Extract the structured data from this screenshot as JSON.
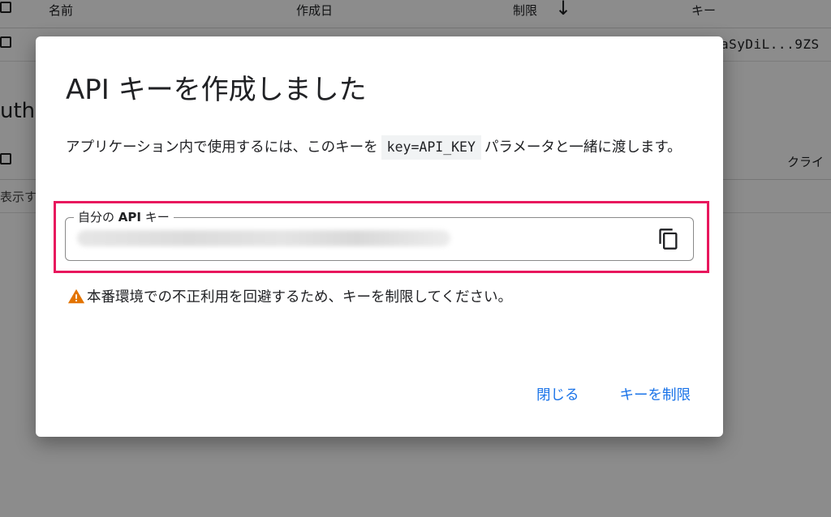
{
  "background": {
    "columns": [
      "名前",
      "作成日",
      "制限",
      "キー"
    ],
    "sort_icon": "arrow-down-icon",
    "row_key_value": "aSyDiL...9ZS",
    "section_title": "uth",
    "table2_header": "クライ",
    "table2_cell": "表示す"
  },
  "dialog": {
    "title": "API キーを作成しました",
    "desc_before": "アプリケーション内で使用するには、このキーを",
    "desc_code": "key=API_KEY",
    "desc_after": "パラメータと一緒に渡します。",
    "key_field_label_prefix": "自分の ",
    "key_field_label_bold": "API",
    "key_field_label_suffix": " キー",
    "key_value": "",
    "copy_icon": "copy-icon",
    "warning_icon": "warning-icon",
    "warning": "本番環境での不正利用を回避するため、キーを制限してください。",
    "close_label": "閉じる",
    "restrict_label": "キーを制限"
  },
  "colors": {
    "highlight": "#e8175d",
    "accent": "#1a73e8",
    "warning": "#e37400"
  }
}
